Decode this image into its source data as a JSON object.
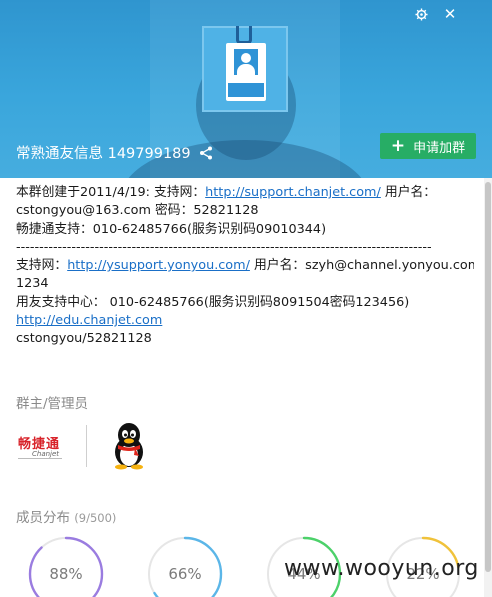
{
  "window": {
    "settings_icon": "settings-gear-icon",
    "close_icon": "close-icon",
    "close_glyph": "✕"
  },
  "header": {
    "avatar_icon": "id-badge-avatar-icon",
    "group_name": "常熟通友信息 149799189",
    "share_icon": "share-icon",
    "join_button_icon": "plus-icon",
    "join_button_label": "申请加群"
  },
  "description": {
    "l1_text": "本群创建于2011/4/19:  支持网：",
    "l1_link": "http://support.chanjet.com/",
    "l1_tail": " 用户名：",
    "l2": "cstongyou@163.com 密码：52821128",
    "l3": "畅捷通支持：010-62485766(服务识别码09010344)",
    "l4": "------------------------------------------------------------------------------------------",
    "l5_text": "支持网：",
    "l5_link": "http://ysupport.yonyou.com/",
    "l5_tail": " 用户名：szyh@channel.yonyou.com",
    "l6": "1234",
    "l7": "用友支持中心：  010-62485766(服务识别码8091504密码123456)",
    "l8_link": "http://edu.chanjet.com",
    "l9": "cstongyou/52821128"
  },
  "admins": {
    "title": "群主/管理员",
    "logo_text": "畅捷通",
    "logo_sub": "Chanjet",
    "admin2_icon": "qq-penguin-icon"
  },
  "distribution": {
    "title": "成员分布",
    "count": "(9/500)",
    "items": [
      {
        "value": "88%",
        "fraction": 0.88,
        "color": "#9a7ce0"
      },
      {
        "value": "66%",
        "fraction": 0.66,
        "color": "#5bb6e8"
      },
      {
        "value": "44%",
        "fraction": 0.44,
        "color": "#4cd16a"
      },
      {
        "value": "22%",
        "fraction": 0.22,
        "color": "#f0c23a"
      }
    ]
  },
  "watermark": "www.wooyun.org"
}
